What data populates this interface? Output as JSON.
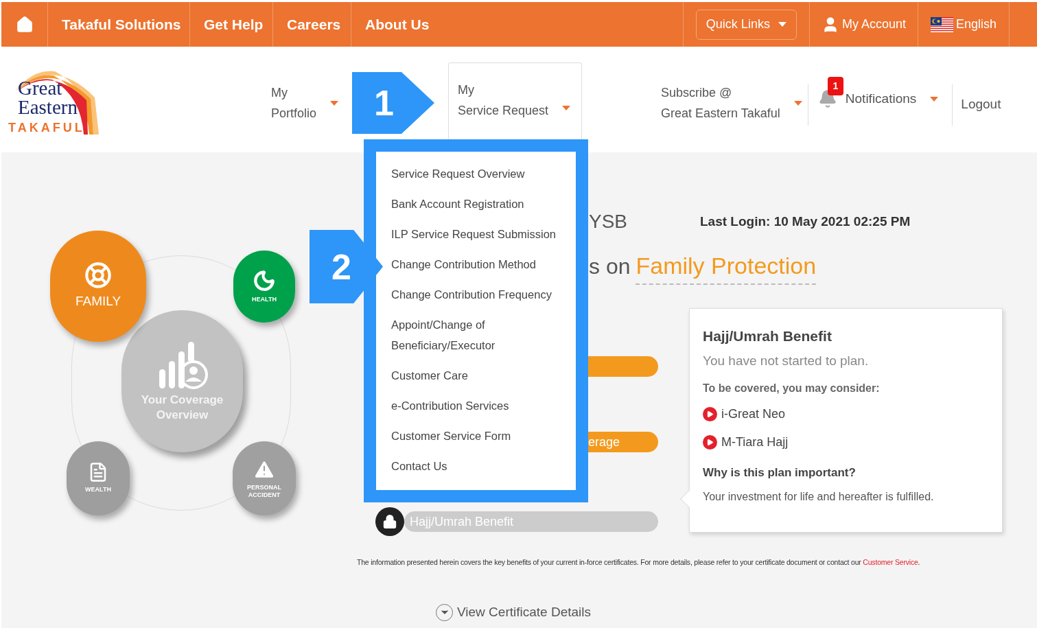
{
  "top_bar": {
    "nav_items": [
      "Takaful Solutions",
      "Get Help",
      "Careers",
      "About Us"
    ],
    "quick_links": "Quick Links",
    "account": "My Account",
    "language": "English"
  },
  "header": {
    "logo": {
      "line_1": "Great",
      "line_2": "Eastern",
      "line_3": "TAKAFUL"
    },
    "menu": [
      {
        "lines": [
          "My",
          "Portfolio"
        ],
        "selected": false
      },
      {
        "lines": [
          "My",
          "Service Request"
        ],
        "selected": true
      },
      {
        "lines": [
          "Subscribe @",
          "Great Eastern Takaful"
        ],
        "selected": false
      }
    ],
    "notifications": {
      "label": "Notifications",
      "badge": "1"
    },
    "logout": "Logout"
  },
  "dropdown": {
    "items": [
      "Service Request Overview",
      "Bank Account Registration",
      "ILP Service Request Submission",
      "Change Contribution Method",
      "Change Contribution Frequency",
      "Appoint/Change of Beneficiary/Executor",
      "Customer Care",
      "e-Contribution Services",
      "Customer Service Form",
      "Contact Us"
    ]
  },
  "callouts": [
    "1",
    "2"
  ],
  "coverage_diagram": {
    "center": [
      "Your Coverage",
      "Overview"
    ],
    "nodes": [
      {
        "kind": "family",
        "lines": [
          "FAMILY"
        ],
        "color": "#ee8a1d"
      },
      {
        "kind": "health",
        "lines": [
          "HEALTH"
        ],
        "color": "#00a14b"
      },
      {
        "kind": "wealth",
        "lines": [
          "WEALTH"
        ],
        "color": "#9e9e9e"
      },
      {
        "kind": "accident",
        "lines": [
          "PERSONAL",
          "ACCIDENT"
        ],
        "color": "#a0a0a0"
      }
    ]
  },
  "greeting_fragment": "YSB",
  "last_login": "Last Login: 10 May 2021 02:25 PM",
  "headline": {
    "prefix": "s on",
    "highlight": "Family Protection"
  },
  "bars": [
    {
      "locked": false
    },
    {
      "locked": false,
      "label": "erage"
    },
    {
      "locked": true,
      "label": "Hajj/Umrah Benefit"
    }
  ],
  "card": {
    "title": "Hajj/Umrah Benefit",
    "subtitle": "You have not started to plan.",
    "consider_label": "To be covered, you may consider:",
    "products": [
      "i-Great Neo",
      "M-Tiara Hajj"
    ],
    "why_title": "Why is this plan important?",
    "why_text": "Your investment for life and hereafter is fulfilled."
  },
  "footer": {
    "note": "The information presented herein covers the key benefits of your current in-force certificates. For more details, please refer to your certificate document or contact our",
    "link": "Customer Service",
    "end": "."
  },
  "view_details": "View Certificate Details"
}
